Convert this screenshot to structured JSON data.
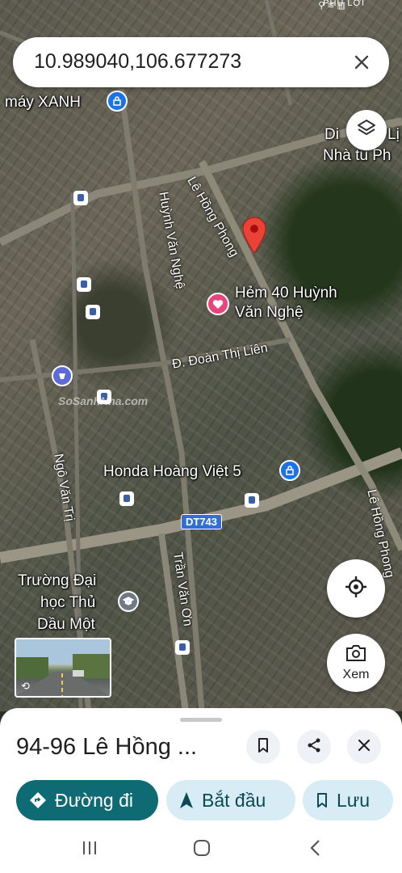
{
  "status_bar": {
    "place": "PHÚ LỢI"
  },
  "search": {
    "query": "10.989040,106.677273"
  },
  "map": {
    "labels": {
      "top_left_store": "máy XANH",
      "top_right_1": "Di",
      "top_right_1b": "Lị",
      "top_right_2": "Nhà tù Ph",
      "hem40_line1": "Hẻm 40 Huỳnh",
      "hem40_line2": "Văn Nghệ",
      "honda": "Honda Hoàng Việt 5",
      "university_line1": "Trường Đại",
      "university_line2": "học Thủ",
      "university_line3": "Dầu Một"
    },
    "streets": {
      "le_hong_phong_top": "Lê Hồng Phong",
      "huynh_van_nghe": "Huỳnh Văn Nghệ",
      "doan_thi_lien": "Đ. Đoàn Thị Liên",
      "ngo_van_tri": "Ngô Văn Trị",
      "tran_van_on": "Trần Văn Ơn",
      "le_hong_phong_right": "Lê Hồng Phong"
    },
    "route_shield": "DT743",
    "watermark": "SoSanhNha.com"
  },
  "controls": {
    "lens_label": "Xem"
  },
  "sheet": {
    "title": "94-96 Lê Hồng ...",
    "buttons": {
      "directions": "Đường đi",
      "start": "Bắt đầu",
      "save": "Lưu"
    }
  },
  "colors": {
    "primary_teal": "#0f6b73",
    "secondary_pill": "#d7ecf5",
    "pin_red": "#ea4335",
    "poi_blue": "#1a73e8",
    "heart_pink": "#e8457d"
  }
}
